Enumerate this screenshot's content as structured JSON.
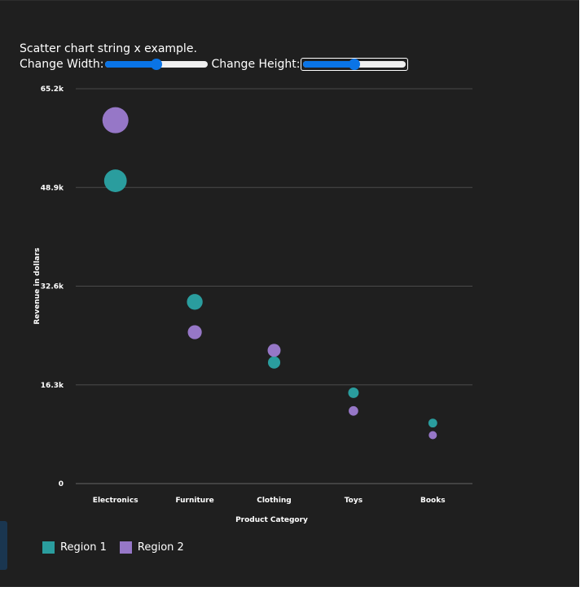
{
  "page": {
    "caption": "Scatter chart string x example.",
    "width_label": "Change Width:",
    "height_label": "Change Height:",
    "width_slider_value": 0.5,
    "height_slider_value": 0.5
  },
  "colors": {
    "background": "#1f1f1f",
    "region1": "#2a9d9e",
    "region2": "#9677c7",
    "gridline": "#4a4a4a",
    "slider_accent": "#0a74e6"
  },
  "chart_data": {
    "type": "scatter",
    "title": "",
    "xlabel": "Product Category",
    "ylabel": "Revenue in dollars",
    "categories": [
      "Electronics",
      "Furniture",
      "Clothing",
      "Toys",
      "Books"
    ],
    "ylim": [
      0,
      65200
    ],
    "yticks": [
      0,
      16300,
      32600,
      48900,
      65200
    ],
    "ytick_labels": [
      "0",
      "16.3k",
      "32.6k",
      "48.9k",
      "65.2k"
    ],
    "grid": true,
    "legend_position": "bottom-left",
    "series": [
      {
        "name": "Region 1",
        "values": [
          50000,
          30000,
          20000,
          15000,
          10000
        ],
        "sizes": [
          50000,
          30000,
          20000,
          15000,
          10000
        ]
      },
      {
        "name": "Region 2",
        "values": [
          60000,
          25000,
          22000,
          12000,
          8000
        ],
        "sizes": [
          60000,
          25000,
          22000,
          12000,
          8000
        ]
      }
    ]
  }
}
